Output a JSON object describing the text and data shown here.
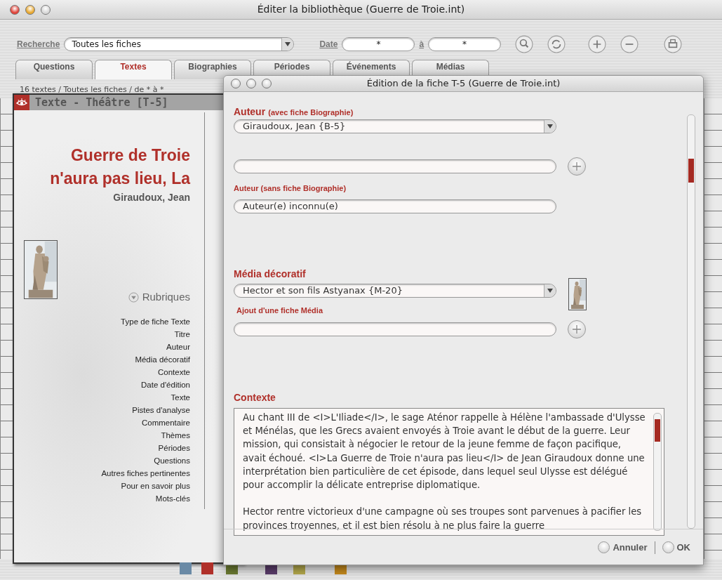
{
  "main_window": {
    "title": "Éditer la bibliothèque (Guerre de Troie.int)"
  },
  "toolbar": {
    "search_label": "Recherche",
    "search_value": "Toutes les fiches",
    "date_label": "Date",
    "date_from": "*",
    "to_label": "à",
    "date_to": "*"
  },
  "tabs": [
    {
      "label": "Questions",
      "selected": false
    },
    {
      "label": "Textes",
      "selected": true
    },
    {
      "label": "Biographies",
      "selected": false
    },
    {
      "label": "Périodes",
      "selected": false
    },
    {
      "label": "Événements",
      "selected": false
    },
    {
      "label": "Médias",
      "selected": false
    }
  ],
  "status_text": "16 textes / Toutes les fiches / de * à *",
  "record_panel": {
    "header": "Texte - Théâtre [T-5]",
    "title": "Guerre de Troie n'aura pas lieu, La",
    "author": "Giraudoux, Jean",
    "rubriques_label": "Rubriques",
    "rubriques": [
      "Type de fiche Texte",
      "Titre",
      "Auteur",
      "Média décoratif",
      "Contexte",
      "Date d'édition",
      "Texte",
      "Pistes d'analyse",
      "Commentaire",
      "Thèmes",
      "Périodes",
      "Questions",
      "Autres fiches pertinentes",
      "Pour en savoir plus",
      "Mots-clés"
    ]
  },
  "swatches": [
    {
      "color": "#6a8aa6"
    },
    {
      "color": "#b0302a"
    },
    {
      "color": "#6b7a32"
    },
    {
      "color": "#5b3d6b"
    },
    {
      "color": "#b3a84c"
    },
    {
      "color": "#c4891c"
    }
  ],
  "dialog": {
    "title": "Édition de la fiche T-5 (Guerre de Troie.int)",
    "sections": [
      {
        "heading": "Auteur",
        "note": "(avec fiche Biographie)",
        "controls": [
          {
            "kind": "select",
            "value": "Giraudoux, Jean {B-5}"
          },
          {
            "kind": "input_add"
          }
        ]
      },
      {
        "subheading": "Auteur (sans fiche Biographie)",
        "controls": [
          {
            "kind": "input",
            "value": "Auteur(e) inconnu(e)"
          }
        ]
      },
      {
        "heading": "Média décoratif",
        "controls": [
          {
            "kind": "select",
            "value": "Hector et son fils Astyanax {M-20}",
            "thumbnail": true
          }
        ]
      },
      {
        "subheading": "Ajout d'une fiche Média",
        "controls": [
          {
            "kind": "input_add"
          }
        ]
      },
      {
        "heading": "Contexte",
        "controls": [
          {
            "kind": "textarea",
            "value": "Au chant III de <I>L'Iliade</I>, le sage Aténor rappelle à Hélène l'ambassade d'Ulysse et Ménélas, que les Grecs avaient envoyés à Troie avant le début de la guerre. Leur mission, qui consistait à négocier le retour de la jeune femme de façon pacifique, avait échoué. <I>La Guerre de Troie n'aura pas lieu</I> de Jean Giraudoux donne une interprétation bien particulière de cet épisode, dans lequel seul Ulysse est délégué pour accomplir la délicate entreprise diplomatique.\n\nHector rentre victorieux d'une campagne où ses troupes sont parvenues à pacifier les provinces troyennes, et il est bien résolu à ne plus faire la guerre"
          }
        ]
      }
    ],
    "buttons": [
      {
        "label": "Annuler"
      },
      {
        "label": "OK"
      }
    ]
  }
}
